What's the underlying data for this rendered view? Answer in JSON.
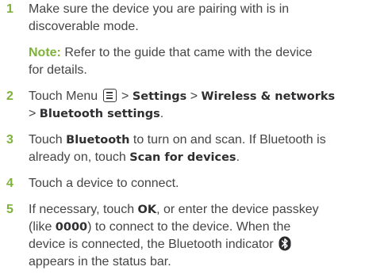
{
  "theme": {
    "accent": "#7fb23b",
    "text": "#454547"
  },
  "steps": [
    {
      "number": "1",
      "line1": "Make sure the device you are pairing with is in",
      "line2": "discoverable mode.",
      "note_label": "Note:",
      "note_line1_rest": " Refer to the guide that came with the device",
      "note_line2": "for details."
    },
    {
      "number": "2",
      "pre": "Touch Menu ",
      "menu_icon": "menu-icon",
      "sep1": " > ",
      "settings": "Settings",
      "sep2": " > ",
      "wireless": "Wireless & networks",
      "sep3": "> ",
      "bt_settings": "Bluetooth settings",
      "post": "."
    },
    {
      "number": "3",
      "pre": "Touch ",
      "bluetooth": "Bluetooth",
      "mid": " to turn on and scan. If Bluetooth is",
      "line2_pre": "already on, touch ",
      "scan": "Scan for devices",
      "post": "."
    },
    {
      "number": "4",
      "text": "Touch a device to connect."
    },
    {
      "number": "5",
      "pre": "If necessary, touch ",
      "ok": "OK",
      "mid": ", or enter the device passkey",
      "line2_pre": "(like ",
      "passkey": "0000",
      "line2_post": ") to connect to the device. When the",
      "line3_pre": "device is connected, the Bluetooth indicator ",
      "bt_icon": "bluetooth-icon",
      "line4": "appears in the status bar."
    }
  ]
}
